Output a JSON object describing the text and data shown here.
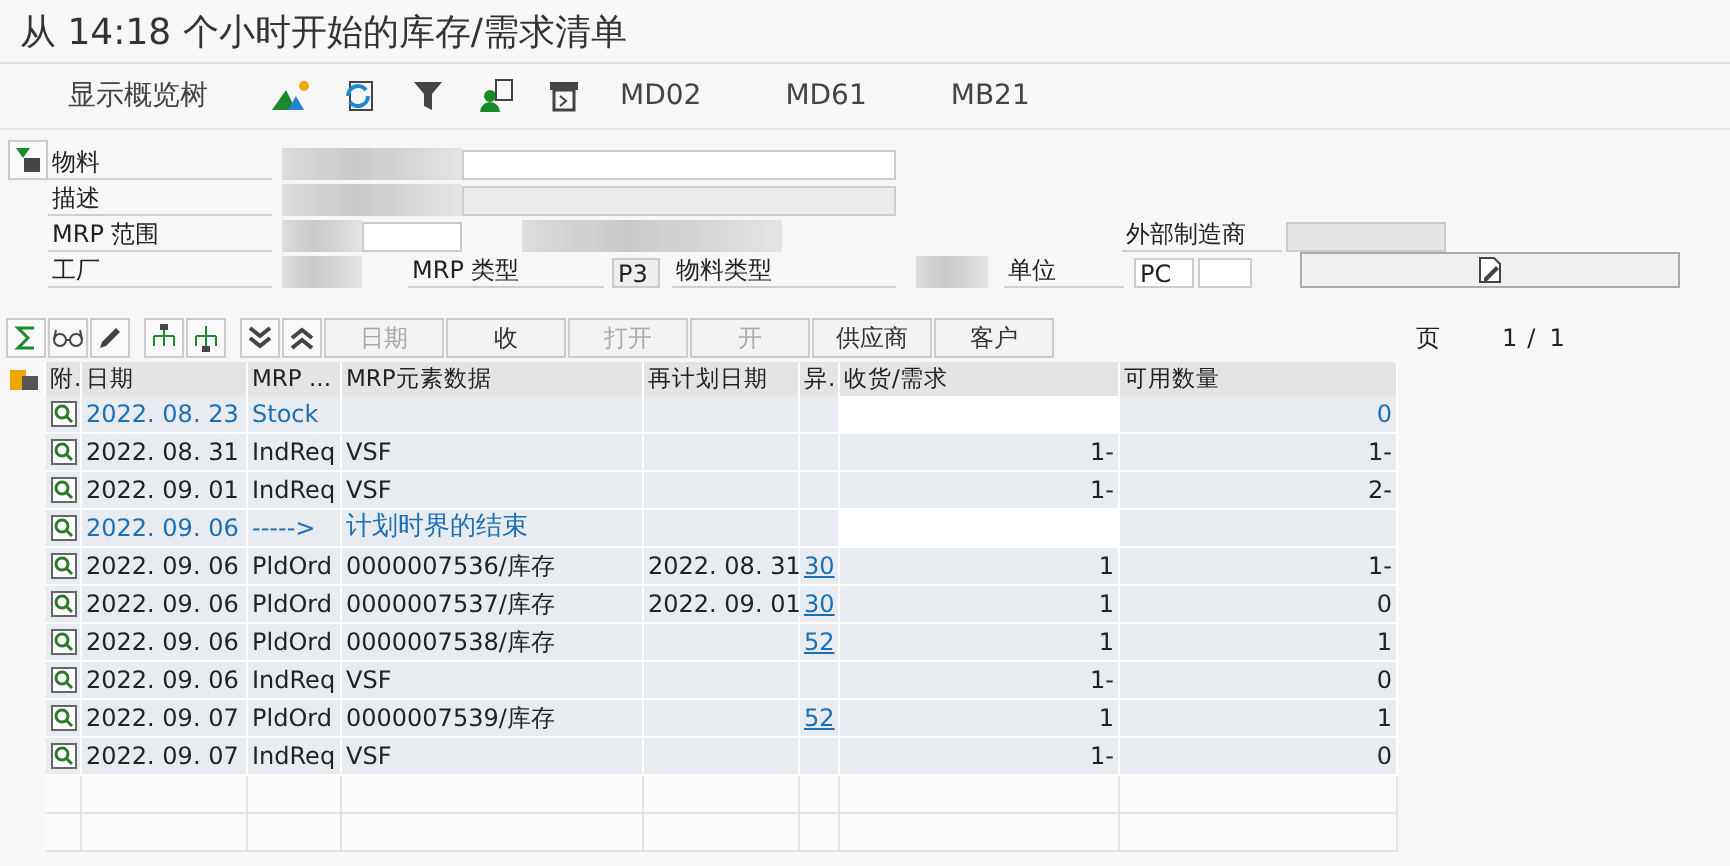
{
  "window": {
    "title": "从 14:18 个小时开始的库存/需求清单"
  },
  "toolbar": {
    "overview_label": "显示概览树",
    "transactions": [
      "MD02",
      "MD61",
      "MB21"
    ]
  },
  "header": {
    "material_label": "物料",
    "description_label": "描述",
    "mrp_area_label": "MRP 范围",
    "plant_label": "工厂",
    "mrp_type_label": "MRP 类型",
    "mrp_type": "P3",
    "material_type_label": "物料类型",
    "unit_label": "单位",
    "unit": "PC",
    "external_manufacturer_label": "外部制造商"
  },
  "table_toolbar": {
    "buttons": [
      {
        "label": "日期",
        "disabled": true
      },
      {
        "label": "收",
        "disabled": false
      },
      {
        "label": "打开",
        "disabled": true
      },
      {
        "label": "开",
        "disabled": true
      },
      {
        "label": "供应商",
        "disabled": false
      },
      {
        "label": "客户",
        "disabled": false
      }
    ],
    "page_label": "页",
    "page": "1",
    "page_separator": "/",
    "page_count": "1"
  },
  "table": {
    "columns": [
      "附.",
      "日期",
      "MRP ...",
      "MRP元素数据",
      "再计划日期",
      "异.",
      "收货/需求",
      "可用数量"
    ],
    "rows": [
      {
        "kind": "stock",
        "date": "2022. 08. 23",
        "element": "Stock",
        "data": "",
        "reschedule": "",
        "exception": "",
        "qty": "",
        "available": "0"
      },
      {
        "kind": "item",
        "date": "2022. 08. 31",
        "element": "IndReq",
        "data": "VSF",
        "reschedule": "",
        "exception": "",
        "qty": "1-",
        "available": "1-"
      },
      {
        "kind": "item",
        "date": "2022. 09. 01",
        "element": "IndReq",
        "data": "VSF",
        "reschedule": "",
        "exception": "",
        "qty": "1-",
        "available": "2-"
      },
      {
        "kind": "horizon",
        "date": "2022. 09. 06",
        "element": "----->",
        "data": "计划时界的结束",
        "reschedule": "",
        "exception": "",
        "qty": "",
        "available": ""
      },
      {
        "kind": "item",
        "date": "2022. 09. 06",
        "element": "PldOrd",
        "data": "0000007536/库存",
        "reschedule": "2022. 08. 31",
        "exception": "30",
        "qty": "1",
        "available": "1-"
      },
      {
        "kind": "item",
        "date": "2022. 09. 06",
        "element": "PldOrd",
        "data": "0000007537/库存",
        "reschedule": "2022. 09. 01",
        "exception": "30",
        "qty": "1",
        "available": "0"
      },
      {
        "kind": "item",
        "date": "2022. 09. 06",
        "element": "PldOrd",
        "data": "0000007538/库存",
        "reschedule": "",
        "exception": "52",
        "qty": "1",
        "available": "1"
      },
      {
        "kind": "item",
        "date": "2022. 09. 06",
        "element": "IndReq",
        "data": "VSF",
        "reschedule": "",
        "exception": "",
        "qty": "1-",
        "available": "0"
      },
      {
        "kind": "item",
        "date": "2022. 09. 07",
        "element": "PldOrd",
        "data": "0000007539/库存",
        "reschedule": "",
        "exception": "52",
        "qty": "1",
        "available": "1"
      },
      {
        "kind": "item",
        "date": "2022. 09. 07",
        "element": "IndReq",
        "data": "VSF",
        "reschedule": "",
        "exception": "",
        "qty": "1-",
        "available": "0"
      }
    ]
  }
}
